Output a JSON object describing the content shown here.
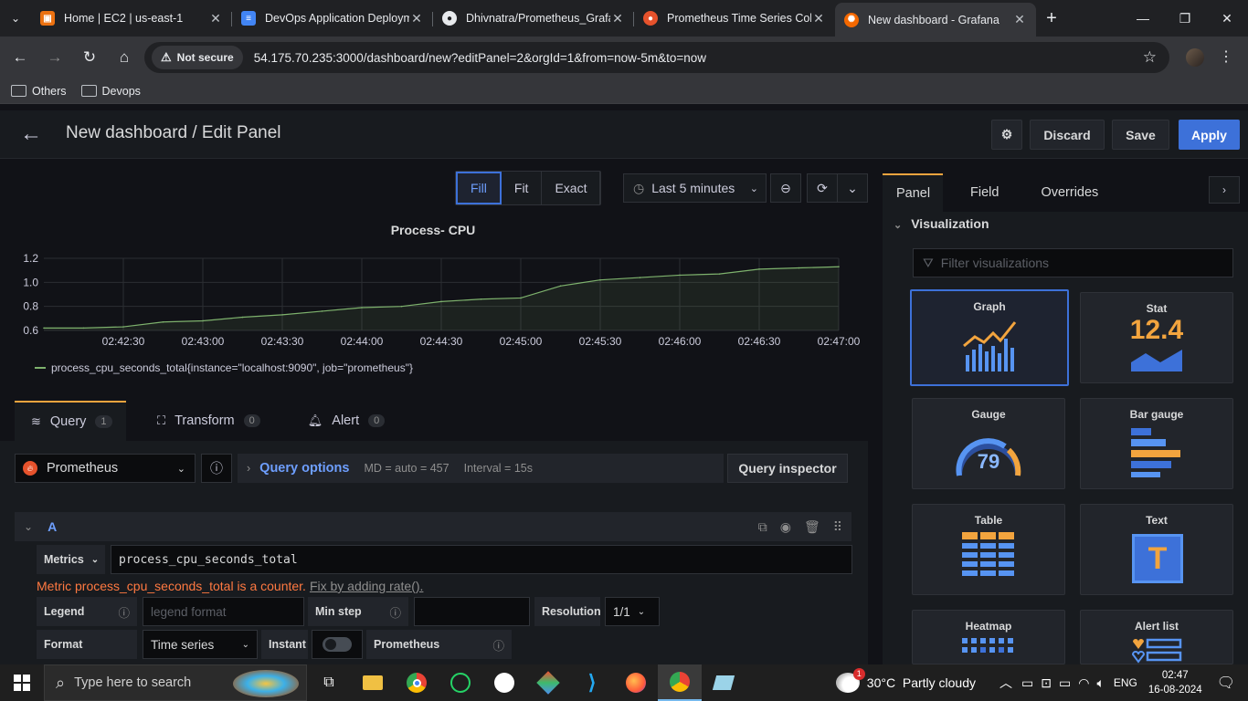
{
  "browser": {
    "tabs": [
      {
        "title": "Home | EC2 | us-east-1",
        "active": false
      },
      {
        "title": "DevOps Application Deploym",
        "active": false
      },
      {
        "title": "Dhivnatra/Prometheus_Grafa",
        "active": false
      },
      {
        "title": "Prometheus Time Series Coll",
        "active": false
      },
      {
        "title": "New dashboard - Grafana",
        "active": true
      }
    ],
    "security_label": "Not secure",
    "url": "54.175.70.235:3000/dashboard/new?editPanel=2&orgId=1&from=now-5m&to=now",
    "bookmarks": [
      "Others",
      "Devops"
    ]
  },
  "header": {
    "title": "New dashboard / Edit Panel",
    "discard_label": "Discard",
    "save_label": "Save",
    "apply_label": "Apply"
  },
  "view_modes": [
    "Fill",
    "Fit",
    "Exact"
  ],
  "active_view_mode": "Fill",
  "time_picker": "Last 5 minutes",
  "chart_data": {
    "type": "line",
    "title": "Process- CPU",
    "x": [
      "02:42:00",
      "02:42:15",
      "02:42:30",
      "02:42:45",
      "02:43:00",
      "02:43:15",
      "02:43:30",
      "02:43:45",
      "02:44:00",
      "02:44:15",
      "02:44:30",
      "02:44:45",
      "02:45:00",
      "02:45:15",
      "02:45:30",
      "02:45:45",
      "02:46:00",
      "02:46:15",
      "02:46:30",
      "02:46:45",
      "02:47:00"
    ],
    "x_tick_labels": [
      "02:42:30",
      "02:43:00",
      "02:43:30",
      "02:44:00",
      "02:44:30",
      "02:45:00",
      "02:45:30",
      "02:46:00",
      "02:46:30",
      "02:47:00"
    ],
    "series": [
      {
        "name": "process_cpu_seconds_total{instance=\"localhost:9090\", job=\"prometheus\"}",
        "color": "#7eb26d",
        "values": [
          0.62,
          0.62,
          0.63,
          0.67,
          0.68,
          0.71,
          0.73,
          0.76,
          0.79,
          0.8,
          0.84,
          0.86,
          0.87,
          0.97,
          1.02,
          1.04,
          1.06,
          1.07,
          1.11,
          1.12,
          1.13
        ]
      }
    ],
    "y_ticks": [
      0.6,
      0.8,
      1.0,
      1.2
    ],
    "ylim": [
      0.6,
      1.2
    ],
    "grid": true,
    "legend_placement": "bottom-left"
  },
  "query": {
    "tabs": [
      {
        "label": "Query",
        "count": "1"
      },
      {
        "label": "Transform",
        "count": "0"
      },
      {
        "label": "Alert",
        "count": "0"
      }
    ],
    "datasource": "Prometheus",
    "options_label": "Query options",
    "md": "MD = auto = 457",
    "interval": "Interval = 15s",
    "inspector_label": "Query inspector",
    "ref": "A",
    "metrics_label": "Metrics",
    "metric_value": "process_cpu_seconds_total",
    "warning": "Metric process_cpu_seconds_total is a counter.",
    "fix_link": "Fix by adding rate().",
    "legend_label": "Legend",
    "legend_placeholder": "legend format",
    "min_step_label": "Min step",
    "resolution_label": "Resolution",
    "resolution_value": "1/1",
    "format_label": "Format",
    "format_value": "Time series",
    "instant_label": "Instant",
    "prometheus_label": "Prometheus"
  },
  "options_pane": {
    "tabs": [
      "Panel",
      "Field",
      "Overrides"
    ],
    "section": "Visualization",
    "filter_placeholder": "Filter visualizations",
    "visualizations": [
      "Graph",
      "Stat",
      "Gauge",
      "Bar gauge",
      "Table",
      "Text",
      "Heatmap",
      "Alert list"
    ],
    "stat_value": "12.4",
    "gauge_value": "79",
    "text_glyph": "T"
  },
  "taskbar": {
    "search_placeholder": "Type here to search",
    "weather": "30°C  Partly cloudy",
    "lang": "ENG",
    "time": "02:47",
    "date": "16-08-2024",
    "weather_badge": "1"
  }
}
